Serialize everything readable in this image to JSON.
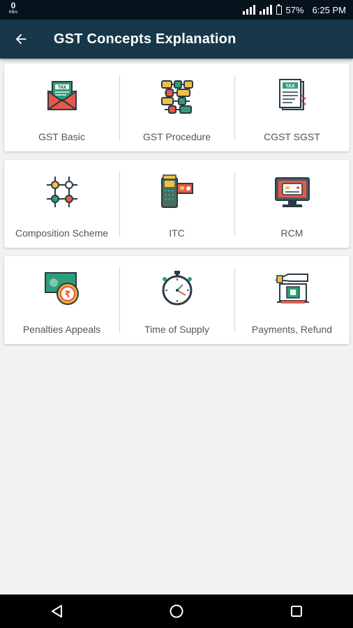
{
  "status_bar": {
    "net_speed": "0",
    "net_unit": "KB/s",
    "battery": "57%",
    "time": "6:25 PM"
  },
  "app_bar": {
    "title": "GST Concepts Explanation",
    "back_icon": "arrow-back-icon"
  },
  "grid": {
    "rows": [
      {
        "tiles": [
          {
            "label": "GST Basic",
            "icon": "tax-envelope-icon"
          },
          {
            "label": "GST Procedure",
            "icon": "flowchart-icon"
          },
          {
            "label": "CGST SGST",
            "icon": "tax-document-icon"
          }
        ]
      },
      {
        "tiles": [
          {
            "label": "Composition Scheme",
            "icon": "network-nodes-icon"
          },
          {
            "label": "ITC",
            "icon": "card-machine-icon"
          },
          {
            "label": "RCM",
            "icon": "computer-card-icon"
          }
        ]
      },
      {
        "tiles": [
          {
            "label": "Penalties Appeals",
            "icon": "rupee-coin-note-icon"
          },
          {
            "label": "Time of Supply",
            "icon": "stopwatch-icon"
          },
          {
            "label": "Payments, Refund",
            "icon": "hand-payment-icon"
          }
        ]
      }
    ]
  },
  "nav_bar": {
    "back": "triangle-back-icon",
    "home": "circle-home-icon",
    "recents": "square-recents-icon"
  },
  "colors": {
    "status_bar": "#06121c",
    "app_bar": "#17374a",
    "background": "#f2f2f2",
    "card": "#ffffff",
    "label": "#555555"
  }
}
